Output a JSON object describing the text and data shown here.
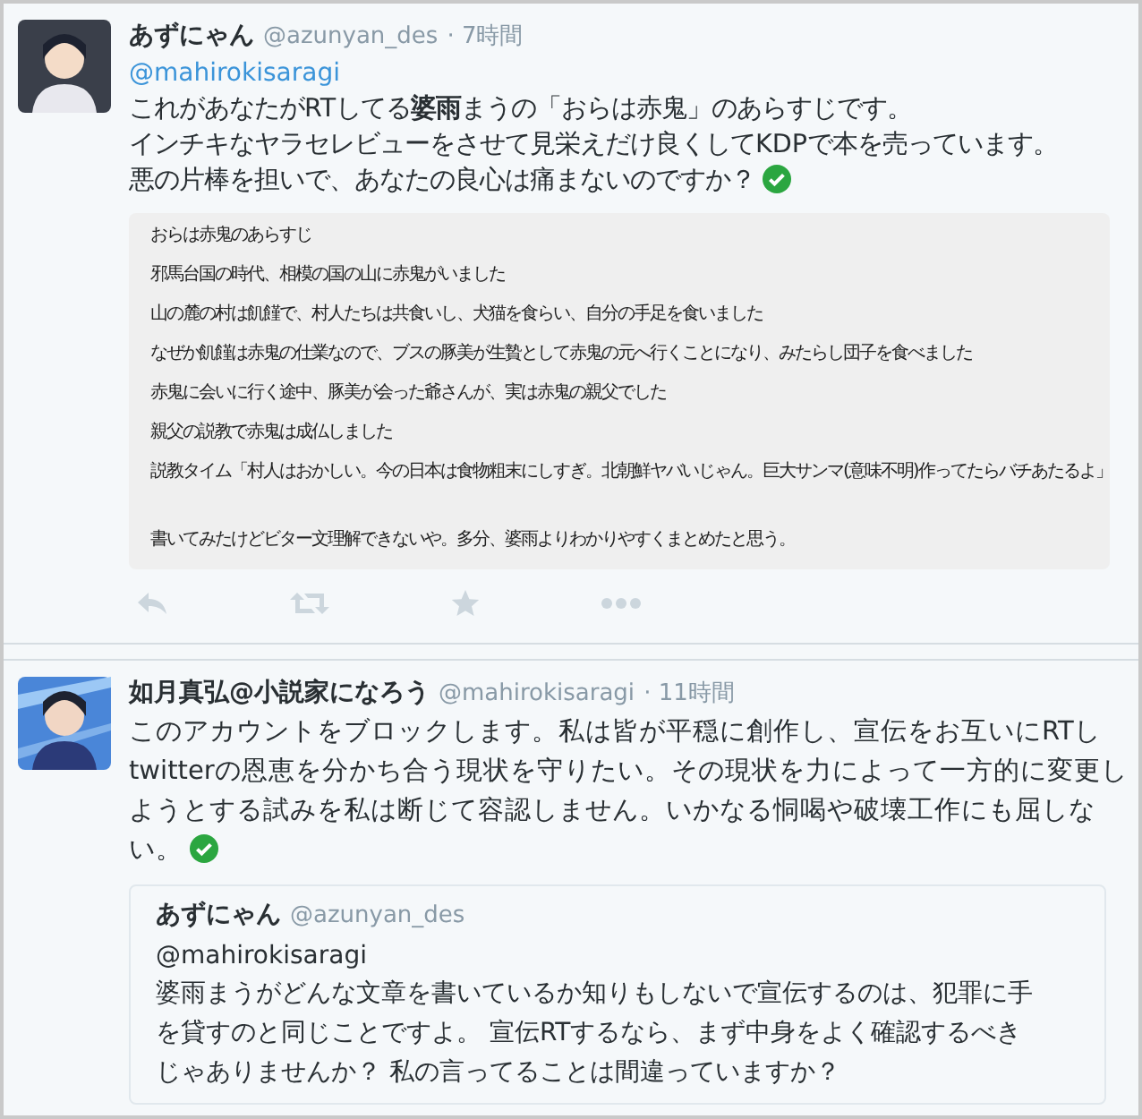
{
  "tweets": [
    {
      "name": "あずにゃん",
      "handle": "@azunyan_des",
      "time": "· 7時間",
      "reply_to": "@mahirokisaragi",
      "lines": [
        "これがあなたがRTしてる**婆雨**まうの「おらは赤鬼」のあらすじです。",
        "インチキなヤラセレビューをさせて見栄えだけ良くしてKDPで本を売っています。",
        "悪の片棒を担いで、あなたの良心は痛まないのですか？"
      ],
      "verified_mark": true,
      "attached_image": {
        "lines": [
          "おらは赤鬼のあらすじ",
          "邪馬台国の時代、相模の国の山に赤鬼がいました",
          "山の麓の村は飢饉で、村人たちは共食いし、犬猫を食らい、自分の手足を食いました",
          "なぜか飢饉は赤鬼の仕業なので、ブスの豚美が生贄として赤鬼の元へ行くことになり、みたらし団子を食べました",
          "赤鬼に会いに行く途中、豚美が会った爺さんが、実は赤鬼の親父でした",
          "親父の説教で赤鬼は成仏しました",
          "説教タイム「村人はおかしい。今の日本は食物粗末にしすぎ。北朝鮮ヤバいじゃん。巨大サンマ(意味不明)作ってたらバチあたるよ」"
        ],
        "footer": "書いてみたけどビター文理解できないや。多分、婆雨よりわかりやすくまとめたと思う。"
      }
    },
    {
      "name": "如月真弘@小説家になろう",
      "handle": "@mahirokisaragi",
      "time": "· 11時間",
      "lines": [
        "このアカウントをブロックします。私は皆が平穏に創作し、宣伝をお互いにRTし",
        "twitterの恩恵を分かち合う現状を守りたい。その現状を力によって一方的に変更し",
        "ようとする試みを私は断じて容認しません。いかなる恫喝や破壊工作にも屈しな",
        "い。"
      ],
      "verified_mark": true,
      "quoted": {
        "name": "あずにゃん",
        "handle": "@azunyan_des",
        "reply_to": "@mahirokisaragi",
        "lines": [
          "婆雨まうがどんな文章を書いているか知りもしないで宣伝するのは、犯罪に手",
          "を貸すのと同じことですよ。 宣伝RTするなら、まず中身をよく確認するべき",
          "じゃありませんか？ 私の言ってることは間違っていますか？"
        ]
      }
    }
  ]
}
